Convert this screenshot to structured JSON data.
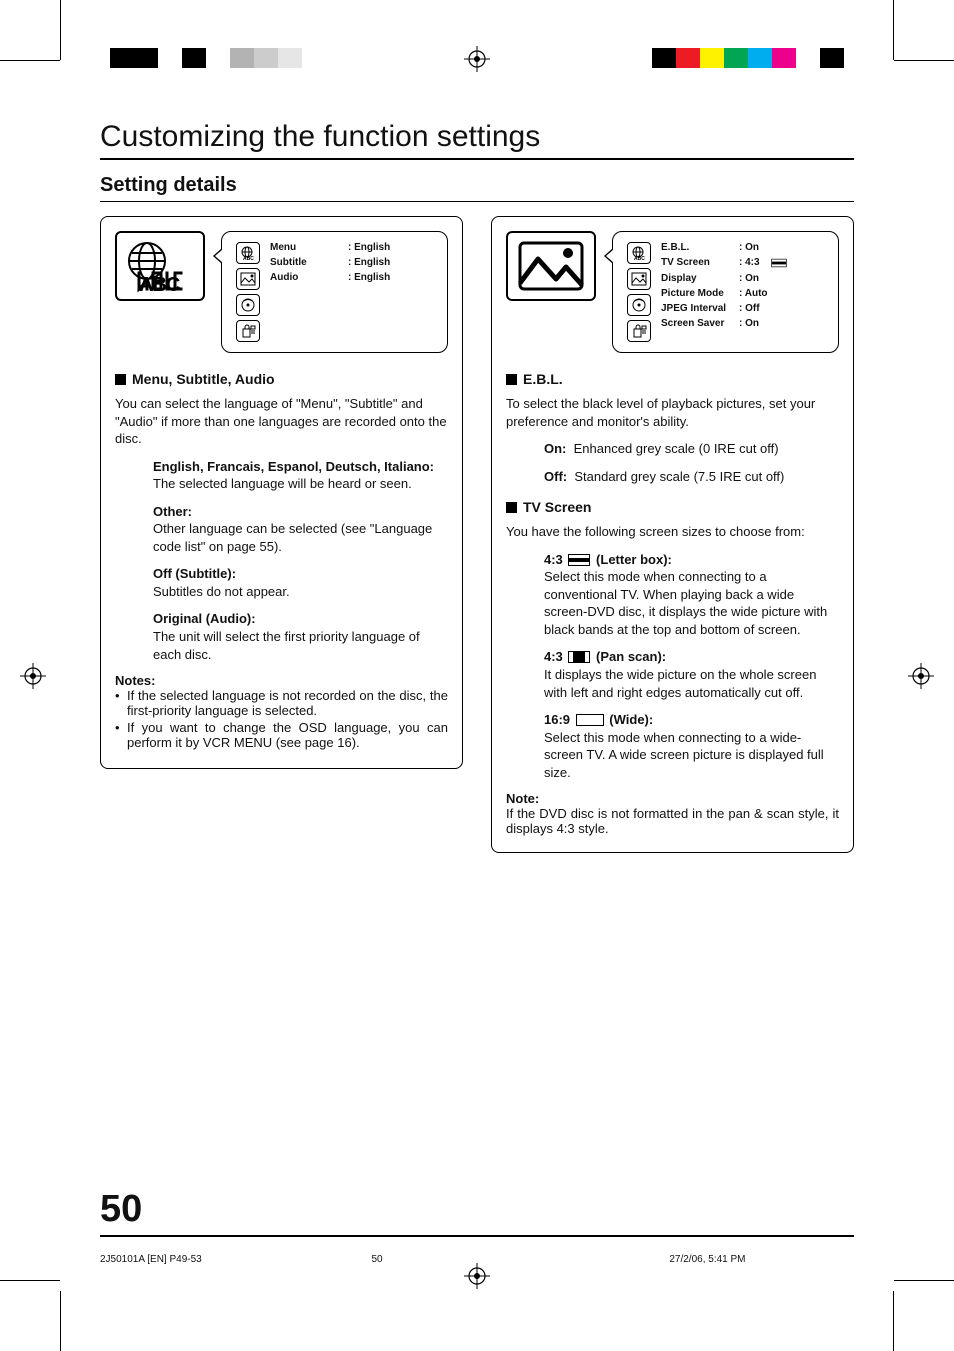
{
  "pageTitle": "Customizing the function settings",
  "sectionTitle": "Setting details",
  "pageNumber": "50",
  "footer": {
    "left": "2J50101A [EN] P49-53",
    "center": "50",
    "right": "27/2/06, 5:41 PM"
  },
  "colorbars": {
    "left": [
      "#000000",
      "#000000",
      "#ffffff",
      "#000000",
      "#ffffff",
      "#b3b3b3",
      "#cccccc",
      "#e6e6e6"
    ],
    "right": [
      "#000000",
      "#ed1c24",
      "#fff200",
      "#00a651",
      "#00aeef",
      "#ec008c",
      "#ffffff",
      "#000000"
    ]
  },
  "leftPanel": {
    "osd": {
      "rows": [
        {
          "key": "Menu",
          "val": ": English"
        },
        {
          "key": "Subtitle",
          "val": ": English"
        },
        {
          "key": "Audio",
          "val": ": English"
        }
      ]
    },
    "subHead": "Menu, Subtitle, Audio",
    "intro": "You can select the language of \"Menu\", \"Subtitle\" and \"Audio\" if more than one languages are recorded onto the disc.",
    "blocks": [
      {
        "head": "English, Francais, Espanol, Deutsch, Italiano:",
        "body": "The selected language will be heard or seen."
      },
      {
        "head": "Other:",
        "body": "Other language can be selected (see \"Language code list\" on page 55)."
      },
      {
        "head": "Off (Subtitle):",
        "body": "Subtitles do not appear."
      },
      {
        "head": "Original (Audio):",
        "body": "The unit will select the first priority language of each disc."
      }
    ],
    "notesHead": "Notes:",
    "notes": [
      "If the selected language is not recorded on the disc, the first-priority language is selected.",
      "If you want to change the OSD language, you can perform it by VCR MENU (see page 16)."
    ]
  },
  "rightPanel": {
    "osd": {
      "rows": [
        {
          "key": "E.B.L.",
          "val": ": On"
        },
        {
          "key": "TV Screen",
          "val": ": 4:3",
          "aspect": "let"
        },
        {
          "key": "Display",
          "val": ": On"
        },
        {
          "key": "Picture Mode",
          "val": ": Auto"
        },
        {
          "key": "JPEG Interval",
          "val": ": Off"
        },
        {
          "key": "Screen Saver",
          "val": ": On"
        }
      ]
    },
    "eblHead": "E.B.L.",
    "eblIntro": "To select the black level of playback pictures, set your preference and monitor's ability.",
    "eblOn": {
      "key": "On:",
      "body": "Enhanced grey scale (0 IRE cut off)"
    },
    "eblOff": {
      "key": "Off:",
      "body": "Standard grey scale (7.5 IRE cut off)"
    },
    "tvHead": "TV Screen",
    "tvIntro": "You have the following screen sizes to choose from:",
    "tvLetter": {
      "label": "4:3",
      "suffix": "(Letter box):",
      "body": "Select this mode when connecting to a conventional TV. When playing back a wide screen-DVD disc, it displays the wide picture with black bands at the top and bottom of screen."
    },
    "tvPan": {
      "label": "4:3",
      "suffix": "(Pan scan):",
      "body": "It displays the wide picture on the whole screen with left and right edges automatically cut off."
    },
    "tvWide": {
      "label": "16:9",
      "suffix": "(Wide):",
      "body": "Select this mode when connecting to a wide-screen TV. A wide screen picture is displayed full size."
    },
    "noteHead": "Note:",
    "note": "If the DVD disc is not formatted in the pan & scan style, it displays 4:3 style."
  }
}
